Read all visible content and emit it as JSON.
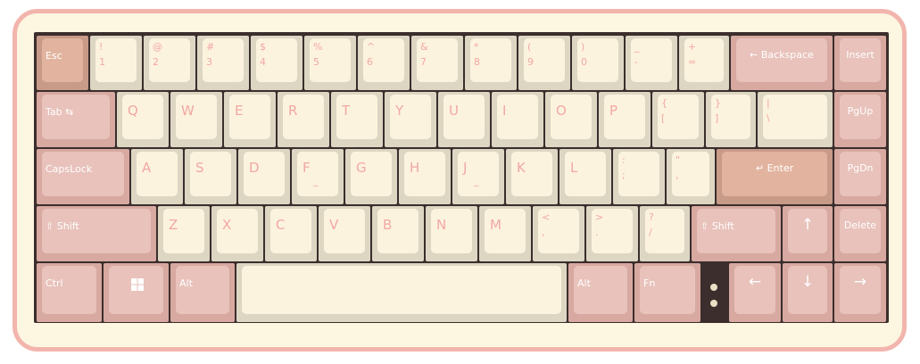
{
  "keyboard": {
    "colors": {
      "case": "#fdf6e1",
      "case_border": "#f2b5ad",
      "plate": "#3b2e2c",
      "alpha_cap": "#fcf3de",
      "mod_cap": "#e8c2bb",
      "legend": "#f2a8a4"
    },
    "row1": [
      {
        "id": "esc",
        "type": "mod-accent",
        "label": "Esc"
      },
      {
        "id": "1",
        "type": "alpha",
        "shift": "!",
        "base": "1"
      },
      {
        "id": "2",
        "type": "alpha",
        "shift": "@",
        "base": "2"
      },
      {
        "id": "3",
        "type": "alpha",
        "shift": "#",
        "base": "3"
      },
      {
        "id": "4",
        "type": "alpha",
        "shift": "$",
        "base": "4"
      },
      {
        "id": "5",
        "type": "alpha",
        "shift": "%",
        "base": "5"
      },
      {
        "id": "6",
        "type": "alpha",
        "shift": "^",
        "base": "6"
      },
      {
        "id": "7",
        "type": "alpha",
        "shift": "&",
        "base": "7"
      },
      {
        "id": "8",
        "type": "alpha",
        "shift": "*",
        "base": "8"
      },
      {
        "id": "9",
        "type": "alpha",
        "shift": "(",
        "base": "9"
      },
      {
        "id": "0",
        "type": "alpha",
        "shift": ")",
        "base": "0"
      },
      {
        "id": "minus",
        "type": "alpha",
        "shift": "_",
        "base": "-"
      },
      {
        "id": "equal",
        "type": "alpha",
        "shift": "+",
        "base": "="
      },
      {
        "id": "backspace",
        "type": "mod",
        "label": "← Backspace"
      },
      {
        "id": "insert",
        "type": "mod",
        "label": "Insert"
      }
    ],
    "row2": [
      {
        "id": "tab",
        "type": "mod",
        "label": "Tab ⇆"
      },
      {
        "id": "q",
        "type": "alpha",
        "single": "Q"
      },
      {
        "id": "w",
        "type": "alpha",
        "single": "W"
      },
      {
        "id": "e",
        "type": "alpha",
        "single": "E"
      },
      {
        "id": "r",
        "type": "alpha",
        "single": "R"
      },
      {
        "id": "t",
        "type": "alpha",
        "single": "T"
      },
      {
        "id": "y",
        "type": "alpha",
        "single": "Y"
      },
      {
        "id": "u",
        "type": "alpha",
        "single": "U"
      },
      {
        "id": "i",
        "type": "alpha",
        "single": "I"
      },
      {
        "id": "o",
        "type": "alpha",
        "single": "O"
      },
      {
        "id": "p",
        "type": "alpha",
        "single": "P"
      },
      {
        "id": "lbracket",
        "type": "alpha",
        "shift": "{",
        "base": "["
      },
      {
        "id": "rbracket",
        "type": "alpha",
        "shift": "}",
        "base": "]"
      },
      {
        "id": "backslash",
        "type": "alpha",
        "shift": "|",
        "base": "\\"
      },
      {
        "id": "pgup",
        "type": "mod",
        "label": "PgUp"
      }
    ],
    "row3": [
      {
        "id": "capslock",
        "type": "mod",
        "label": "CapsLock"
      },
      {
        "id": "a",
        "type": "alpha",
        "single": "A"
      },
      {
        "id": "s",
        "type": "alpha",
        "single": "S"
      },
      {
        "id": "d",
        "type": "alpha",
        "single": "D"
      },
      {
        "id": "f",
        "type": "alpha",
        "single": "F",
        "homing": "_"
      },
      {
        "id": "g",
        "type": "alpha",
        "single": "G"
      },
      {
        "id": "h",
        "type": "alpha",
        "single": "H"
      },
      {
        "id": "j",
        "type": "alpha",
        "single": "J",
        "homing": "_"
      },
      {
        "id": "k",
        "type": "alpha",
        "single": "K"
      },
      {
        "id": "l",
        "type": "alpha",
        "single": "L"
      },
      {
        "id": "semicolon",
        "type": "alpha",
        "shift": ":",
        "base": ";"
      },
      {
        "id": "quote",
        "type": "alpha",
        "shift": "\"",
        "base": ","
      },
      {
        "id": "enter",
        "type": "mod-accent",
        "label": "↵ Enter"
      },
      {
        "id": "pgdn",
        "type": "mod",
        "label": "PgDn"
      }
    ],
    "row4": [
      {
        "id": "lshift",
        "type": "mod",
        "label": "⇧ Shift"
      },
      {
        "id": "z",
        "type": "alpha",
        "single": "Z"
      },
      {
        "id": "x",
        "type": "alpha",
        "single": "X"
      },
      {
        "id": "c",
        "type": "alpha",
        "single": "C"
      },
      {
        "id": "v",
        "type": "alpha",
        "single": "V"
      },
      {
        "id": "b",
        "type": "alpha",
        "single": "B"
      },
      {
        "id": "n",
        "type": "alpha",
        "single": "N"
      },
      {
        "id": "m",
        "type": "alpha",
        "single": "M"
      },
      {
        "id": "comma",
        "type": "alpha",
        "shift": "<",
        "base": ","
      },
      {
        "id": "period",
        "type": "alpha",
        "shift": ">",
        "base": "."
      },
      {
        "id": "slash",
        "type": "alpha",
        "shift": "?",
        "base": "/"
      },
      {
        "id": "rshift",
        "type": "mod",
        "label": "⇧ Shift"
      },
      {
        "id": "up",
        "type": "mod",
        "arrow": "↑"
      },
      {
        "id": "delete",
        "type": "mod",
        "label": "Delete"
      }
    ],
    "row5": [
      {
        "id": "ctrl",
        "type": "mod",
        "label": "Ctrl"
      },
      {
        "id": "win",
        "type": "mod",
        "icon": "windows-icon"
      },
      {
        "id": "lalt",
        "type": "mod",
        "label": "Alt"
      },
      {
        "id": "space",
        "type": "alpha",
        "label": ""
      },
      {
        "id": "ralt",
        "type": "mod",
        "label": "Alt"
      },
      {
        "id": "fn",
        "type": "mod",
        "label": "Fn"
      },
      {
        "id": "left",
        "type": "mod",
        "arrow": "←"
      },
      {
        "id": "down",
        "type": "mod",
        "arrow": "↓"
      },
      {
        "id": "right",
        "type": "mod",
        "arrow": "→"
      }
    ]
  }
}
